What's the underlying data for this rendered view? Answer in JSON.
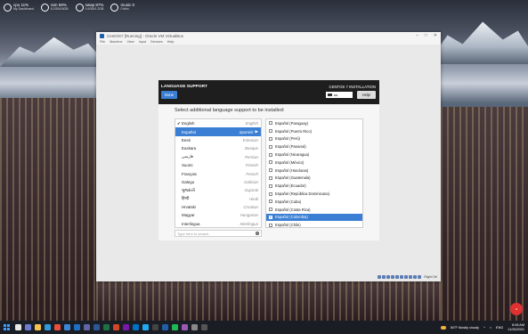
{
  "desktop": {
    "widgets": [
      {
        "main": "cpu 11%",
        "sub": "My Dashboard"
      },
      {
        "main": "ram 59%",
        "sub": "8.2GB/16GB"
      },
      {
        "main": "swap 87%",
        "sub": "0.9GB/1.2GB"
      },
      {
        "main": "music 0",
        "sub": "0 kb/s"
      }
    ]
  },
  "vm": {
    "title": "CentOS7 [Running] - Oracle VM VirtualBox",
    "menu": [
      "File",
      "Machine",
      "View",
      "Input",
      "Devices",
      "Help"
    ],
    "host_key": "Right Ctrl"
  },
  "installer": {
    "title": "LANGUAGE SUPPORT",
    "done_label": "Done",
    "product": "CENTOS 7 INSTALLATION",
    "keyboard_layout": "us",
    "help_label": "Help!",
    "prompt": "Select additional language support to be installed:",
    "languages": [
      {
        "native": "English",
        "english": "English",
        "checked": true,
        "selected": false
      },
      {
        "native": "Español",
        "english": "Spanish",
        "checked": false,
        "selected": true
      },
      {
        "native": "Eesti",
        "english": "Estonian",
        "checked": false,
        "selected": false
      },
      {
        "native": "Euskara",
        "english": "Basque",
        "checked": false,
        "selected": false
      },
      {
        "native": "فارسی",
        "english": "Persian",
        "checked": false,
        "selected": false
      },
      {
        "native": "Suomi",
        "english": "Finnish",
        "checked": false,
        "selected": false
      },
      {
        "native": "Français",
        "english": "French",
        "checked": false,
        "selected": false
      },
      {
        "native": "Galego",
        "english": "Galician",
        "checked": false,
        "selected": false
      },
      {
        "native": "ગુજરાતી",
        "english": "Gujarati",
        "checked": false,
        "selected": false
      },
      {
        "native": "हिन्दी",
        "english": "Hindi",
        "checked": false,
        "selected": false
      },
      {
        "native": "Hrvatski",
        "english": "Croatian",
        "checked": false,
        "selected": false
      },
      {
        "native": "Magyar",
        "english": "Hungarian",
        "checked": false,
        "selected": false
      },
      {
        "native": "Interlingua",
        "english": "Interlingua",
        "checked": false,
        "selected": false
      }
    ],
    "locales": [
      {
        "label": "Español (Paraguay)",
        "checked": false,
        "selected": false
      },
      {
        "label": "Español (Puerto Rico)",
        "checked": false,
        "selected": false
      },
      {
        "label": "Español (Perú)",
        "checked": false,
        "selected": false
      },
      {
        "label": "Español (Panamá)",
        "checked": false,
        "selected": false
      },
      {
        "label": "Español (Nicaragua)",
        "checked": false,
        "selected": false
      },
      {
        "label": "Español (México)",
        "checked": false,
        "selected": false
      },
      {
        "label": "Español (Honduras)",
        "checked": false,
        "selected": false
      },
      {
        "label": "Español (Guatemala)",
        "checked": false,
        "selected": false
      },
      {
        "label": "Español (Ecuador)",
        "checked": false,
        "selected": false
      },
      {
        "label": "Español (República Dominicana)",
        "checked": false,
        "selected": false
      },
      {
        "label": "Español (Cuba)",
        "checked": false,
        "selected": false
      },
      {
        "label": "Español (Costa Rica)",
        "checked": false,
        "selected": false
      },
      {
        "label": "Español (Colombia)",
        "checked": true,
        "selected": true
      },
      {
        "label": "Español (Chile)",
        "checked": false,
        "selected": false
      }
    ],
    "search_placeholder": "Type here to search."
  },
  "taskbar": {
    "weather": "54°F Mostly cloudy",
    "time": "8:08 AM",
    "date": "11/26/2021",
    "lang": "ENG"
  },
  "colors": {
    "accent": "#3b7fd4",
    "header": "#1e1e1e"
  }
}
